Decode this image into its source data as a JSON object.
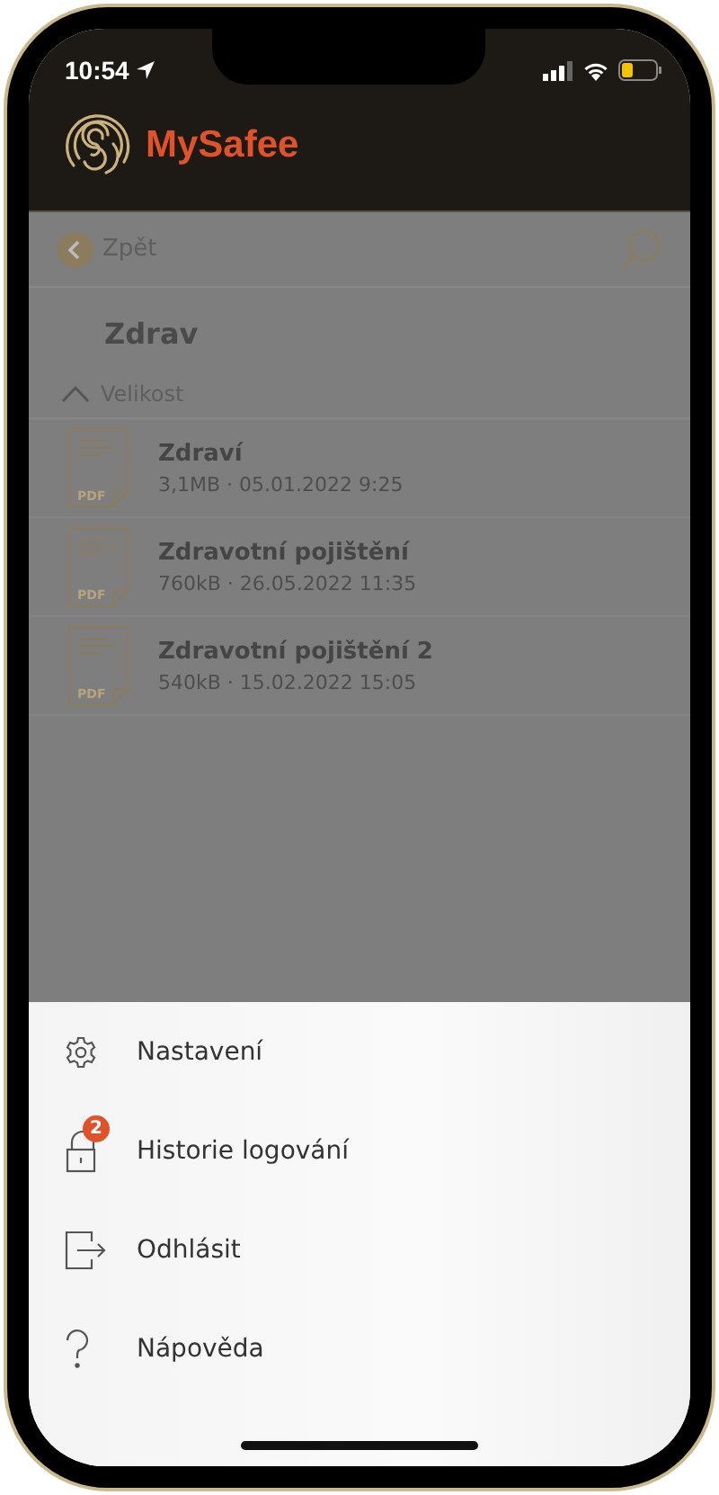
{
  "status_bar": {
    "time": "10:54"
  },
  "app": {
    "name": "MySafee"
  },
  "nav": {
    "back_label": "Zpět"
  },
  "folder": {
    "title": "Zdrav"
  },
  "sort": {
    "label": "Velikost"
  },
  "files": [
    {
      "name": "Zdraví",
      "meta": "3,1MB · 05.01.2022 9:25",
      "file_type": "PDF"
    },
    {
      "name": "Zdravotní pojištění",
      "meta": "760kB · 26.05.2022 11:35",
      "file_type": "PDF"
    },
    {
      "name": "Zdravotní pojištění 2",
      "meta": "540kB · 15.02.2022 15:05",
      "file_type": "PDF"
    }
  ],
  "menu": [
    {
      "kind": "settings",
      "label": "Nastavení"
    },
    {
      "kind": "lock",
      "label": "Historie logování",
      "badge": "2"
    },
    {
      "kind": "logout",
      "label": "Odhlásit"
    },
    {
      "kind": "help",
      "label": "Nápověda"
    }
  ]
}
